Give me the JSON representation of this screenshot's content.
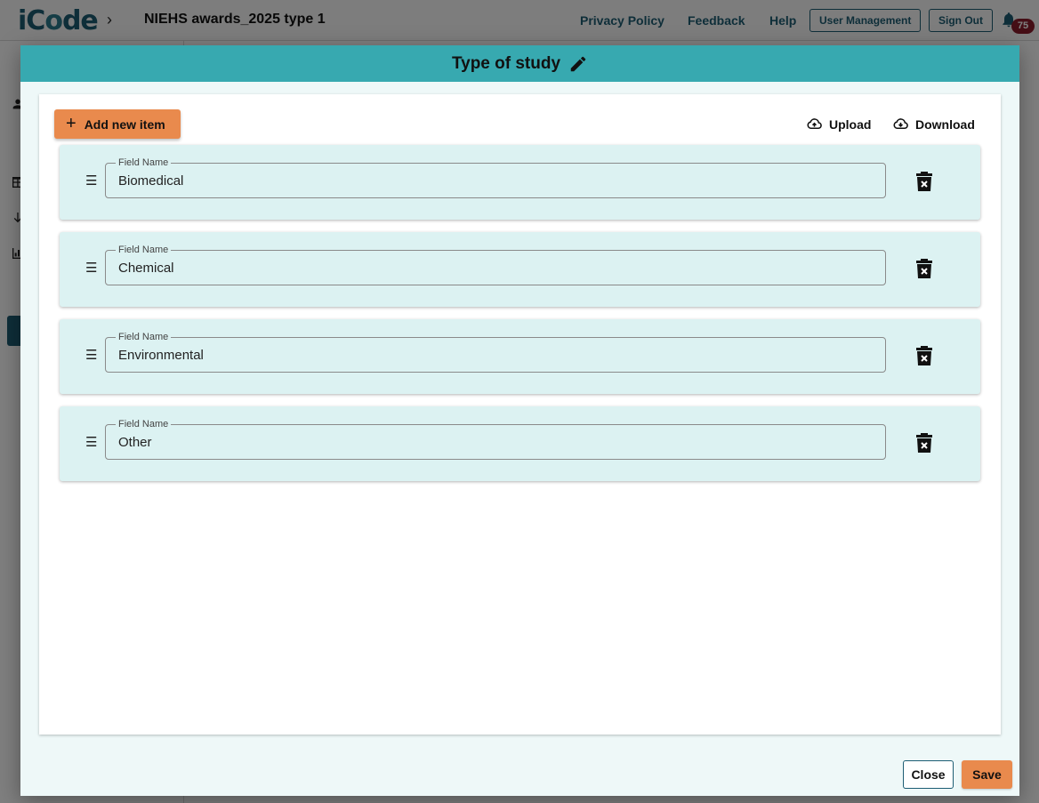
{
  "app": {
    "logo_text_pre": "iC",
    "logo_text_gear": "o",
    "logo_text_post": "de",
    "project_title": "NIEHS awards_2025 type 1",
    "nav": {
      "privacy": "Privacy Policy",
      "feedback": "Feedback",
      "help": "Help",
      "user_management": "User Management",
      "sign_out": "Sign Out"
    },
    "notification_count": "75"
  },
  "modal": {
    "title": "Type of study",
    "add_label": "Add new item",
    "upload_label": "Upload",
    "download_label": "Download",
    "field_label": "Field Name",
    "items": [
      {
        "value": "Biomedical"
      },
      {
        "value": "Chemical"
      },
      {
        "value": "Environmental"
      },
      {
        "value": "Other"
      }
    ],
    "close_label": "Close",
    "save_label": "Save"
  },
  "colors": {
    "header": "#37a9b0",
    "accent": "#e98a4d",
    "card": "#dcf2f2",
    "brand": "#1d5d73",
    "badge": "#8b1d2c"
  }
}
